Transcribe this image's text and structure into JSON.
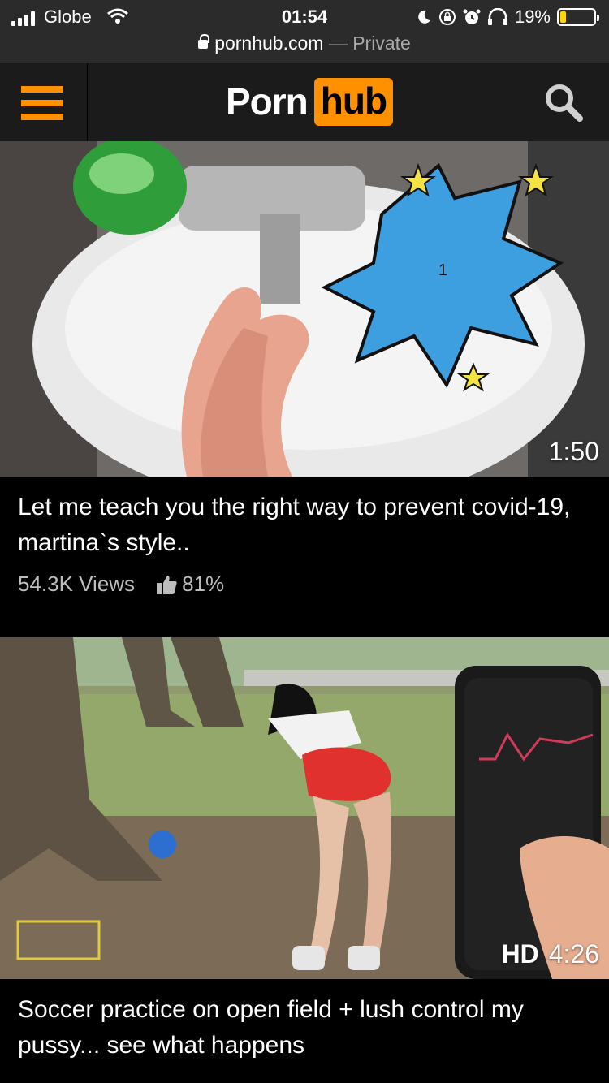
{
  "status_bar": {
    "carrier": "Globe",
    "time": "01:54",
    "battery_percent": "19%",
    "battery_level": 0.19,
    "icons": [
      "signal-icon",
      "wifi-icon",
      "moon-icon",
      "rotation-lock-icon",
      "alarm-icon",
      "headphones-icon",
      "battery-icon"
    ]
  },
  "url_bar": {
    "domain": "pornhub.com",
    "mode": "— Private"
  },
  "header": {
    "logo_part1": "Porn",
    "logo_part2": "hub",
    "accent_color": "#ff9000",
    "icons": [
      "hamburger-menu-icon",
      "search-icon"
    ]
  },
  "videos": [
    {
      "duration": "1:50",
      "hd": "",
      "title": "Let me teach you the right way to prevent covid-19, martina`s style..",
      "views": "54.3K Views",
      "rating": "81%"
    },
    {
      "duration": "4:26",
      "hd": "HD",
      "title": "Soccer practice on open field + lush control my pussy... see what happens",
      "views": "",
      "rating": ""
    }
  ]
}
